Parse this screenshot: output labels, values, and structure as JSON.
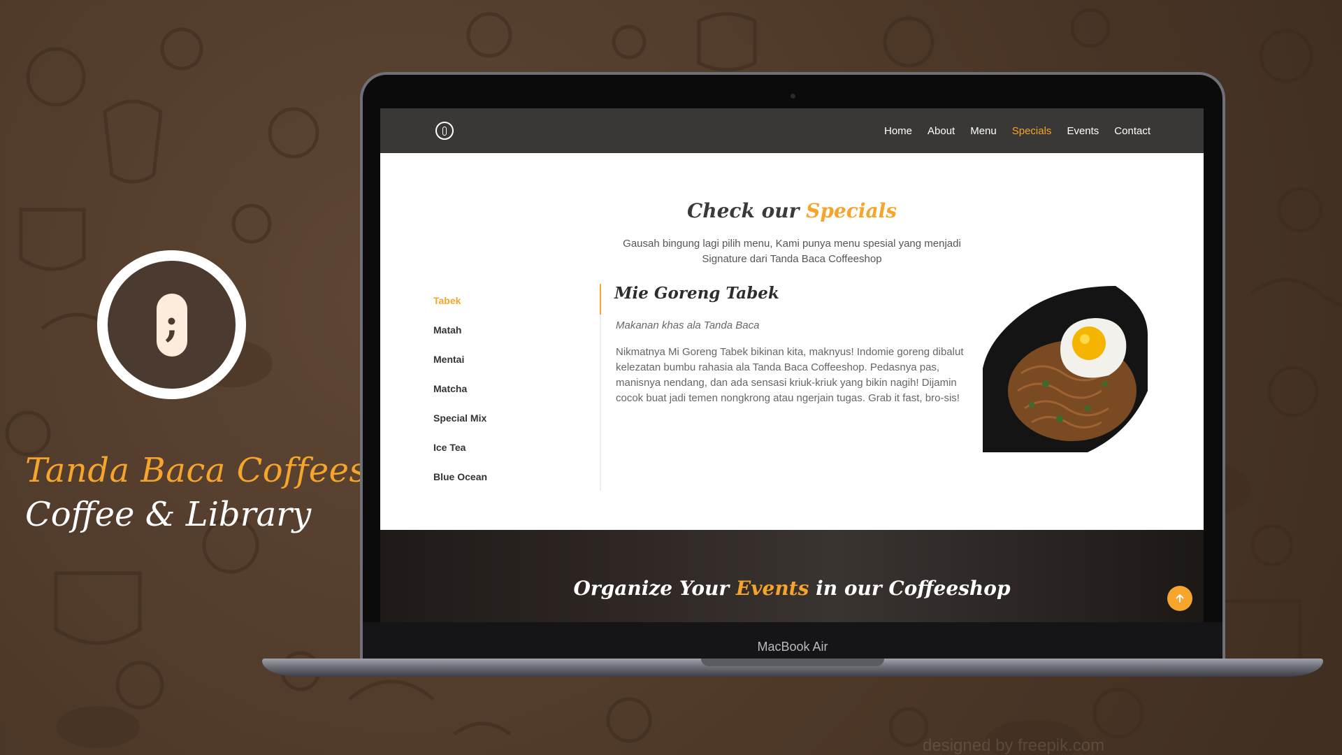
{
  "brand": {
    "title": "Tanda Baca Coffeeshop",
    "subtitle": "Coffee & Library",
    "logo_glyph": ";"
  },
  "laptop": {
    "model_label": "MacBook Air"
  },
  "nav": {
    "items": [
      {
        "label": "Home",
        "active": false
      },
      {
        "label": "About",
        "active": false
      },
      {
        "label": "Menu",
        "active": false
      },
      {
        "label": "Specials",
        "active": true
      },
      {
        "label": "Events",
        "active": false
      },
      {
        "label": "Contact",
        "active": false
      }
    ]
  },
  "specials": {
    "title_prefix": "Check our",
    "title_accent": "Specials",
    "description": "Gausah bingung lagi pilih menu, Kami punya menu spesial yang menjadi Signature dari Tanda Baca Coffeeshop",
    "tabs": [
      {
        "label": "Tabek",
        "active": true
      },
      {
        "label": "Matah",
        "active": false
      },
      {
        "label": "Mentai",
        "active": false
      },
      {
        "label": "Matcha",
        "active": false
      },
      {
        "label": "Special Mix",
        "active": false
      },
      {
        "label": "Ice Tea",
        "active": false
      },
      {
        "label": "Blue Ocean",
        "active": false
      }
    ],
    "selected": {
      "title": "Mie Goreng Tabek",
      "tagline": "Makanan khas ala Tanda Baca",
      "description": "Nikmatnya Mi Goreng Tabek bikinan kita, maknyus! Indomie goreng dibalut kelezatan bumbu rahasia ala Tanda Baca Coffeeshop. Pedasnya pas, manisnya nendang, dan ada sensasi kriuk-kriuk yang bikin nagih! Dijamin cocok buat jadi temen nongkrong atau ngerjain tugas. Grab it fast, bro-sis!"
    }
  },
  "events": {
    "title_prefix": "Organize Your",
    "title_accent": "Events",
    "title_suffix": "in our Coffeeshop"
  },
  "credit": "designed by freepik.com",
  "colors": {
    "accent": "#f5a52c",
    "nav_bg": "#393836",
    "brand_dark": "#4a3a30",
    "background": "#4d3828"
  },
  "icons": {
    "scroll_top": "arrow-up-icon",
    "logo": "semicolon-logo-icon"
  }
}
